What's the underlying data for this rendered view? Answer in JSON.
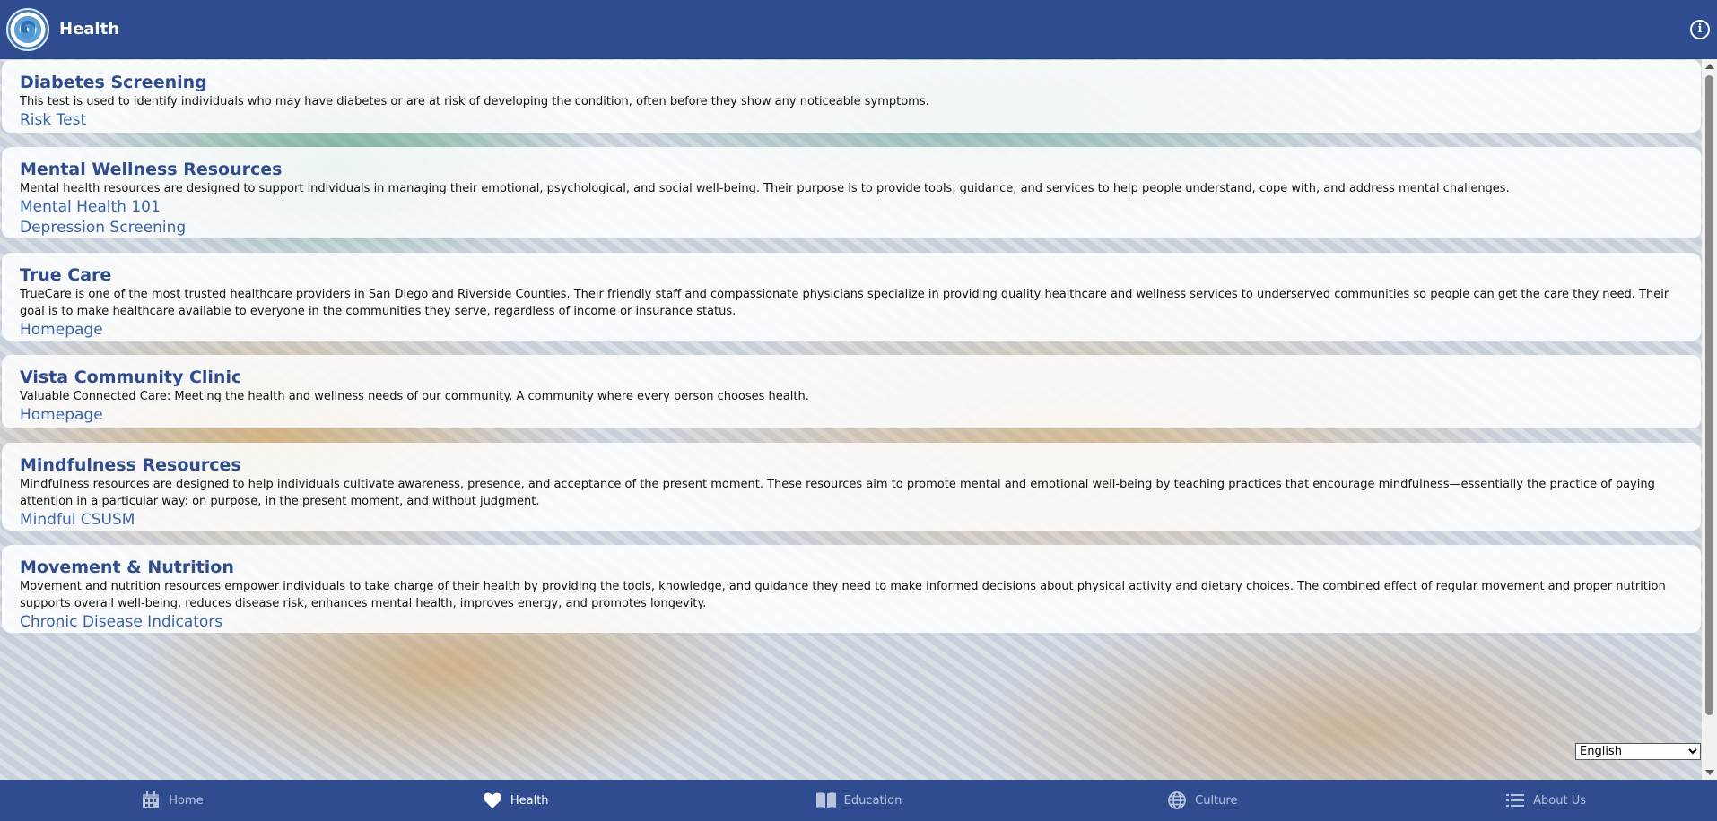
{
  "header": {
    "title": "Health",
    "logo_icon": "college-seal-logo",
    "info_icon": "info-icon"
  },
  "cards": [
    {
      "title": "Diabetes Screening",
      "description": "This test is used to identify individuals who may have diabetes or are at risk of developing the condition, often before they show any noticeable symptoms.",
      "links": [
        "Risk Test"
      ]
    },
    {
      "title": "Mental Wellness Resources",
      "description": "Mental health resources are designed to support individuals in managing their emotional, psychological, and social well-being. Their purpose is to provide tools, guidance, and services to help people understand, cope with, and address mental challenges.",
      "links": [
        "Mental Health 101",
        "Depression Screening"
      ]
    },
    {
      "title": "True Care",
      "description": "TrueCare is one of the most trusted healthcare providers in San Diego and Riverside Counties. Their friendly staff and compassionate physicians specialize in providing quality healthcare and wellness services to underserved communities so people can get the care they need. Their goal is to make healthcare available to everyone in the communities they serve, regardless of income or insurance status.",
      "links": [
        "Homepage"
      ]
    },
    {
      "title": "Vista Community Clinic",
      "description": "Valuable Connected Care: Meeting the health and wellness needs of our community. A community where every person chooses health.",
      "links": [
        "Homepage"
      ]
    },
    {
      "title": "Mindfulness Resources",
      "description": "Mindfulness resources are designed to help individuals cultivate awareness, presence, and acceptance of the present moment. These resources aim to promote mental and emotional well-being by teaching practices that encourage mindfulness—essentially the practice of paying attention in a particular way: on purpose, in the present moment, and without judgment.",
      "links": [
        "Mindful CSUSM"
      ]
    },
    {
      "title": "Movement & Nutrition",
      "description": "Movement and nutrition resources empower individuals to take charge of their health by providing the tools, knowledge, and guidance they need to make informed decisions about physical activity and dietary choices. The combined effect of regular movement and proper nutrition supports overall well-being, reduces disease risk, enhances mental health, improves energy, and promotes longevity.",
      "links": [
        "Chronic Disease Indicators"
      ]
    }
  ],
  "language_select": {
    "selected": "English"
  },
  "bottom_nav": [
    {
      "label": "Home",
      "icon": "calendar-icon",
      "active": false
    },
    {
      "label": "Health",
      "icon": "heart-icon",
      "active": true
    },
    {
      "label": "Education",
      "icon": "book-icon",
      "active": false
    },
    {
      "label": "Culture",
      "icon": "globe-icon",
      "active": false
    },
    {
      "label": "About Us",
      "icon": "list-icon",
      "active": false
    }
  ],
  "colors": {
    "brand": "#2e4c8f",
    "link": "#3b62a8"
  }
}
